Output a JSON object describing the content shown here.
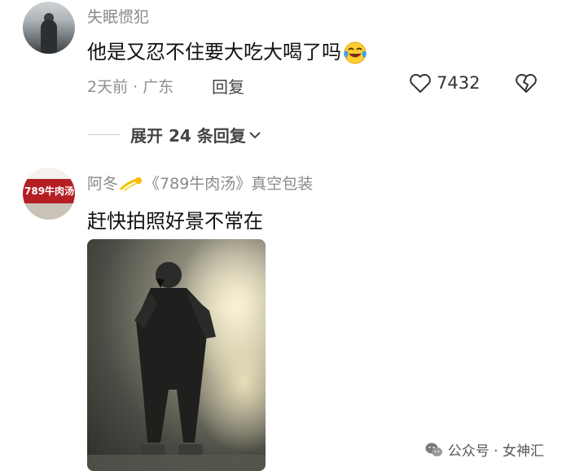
{
  "comments": [
    {
      "username": "失眠惯犯",
      "text": "他是又忍不住要大吃大喝了吗",
      "emoji": "laughing-crying-emoji",
      "meta": "2天前 · 广东",
      "reply_label": "回复",
      "likes": "7432"
    },
    {
      "username": "阿冬",
      "user_tag": "《789牛肉汤》真空包装",
      "avatar_text": "789牛肉汤",
      "text": "赶快拍照好景不常在"
    }
  ],
  "expand_replies": "展开 24 条回复",
  "watermark": "公众号 · 女神汇"
}
